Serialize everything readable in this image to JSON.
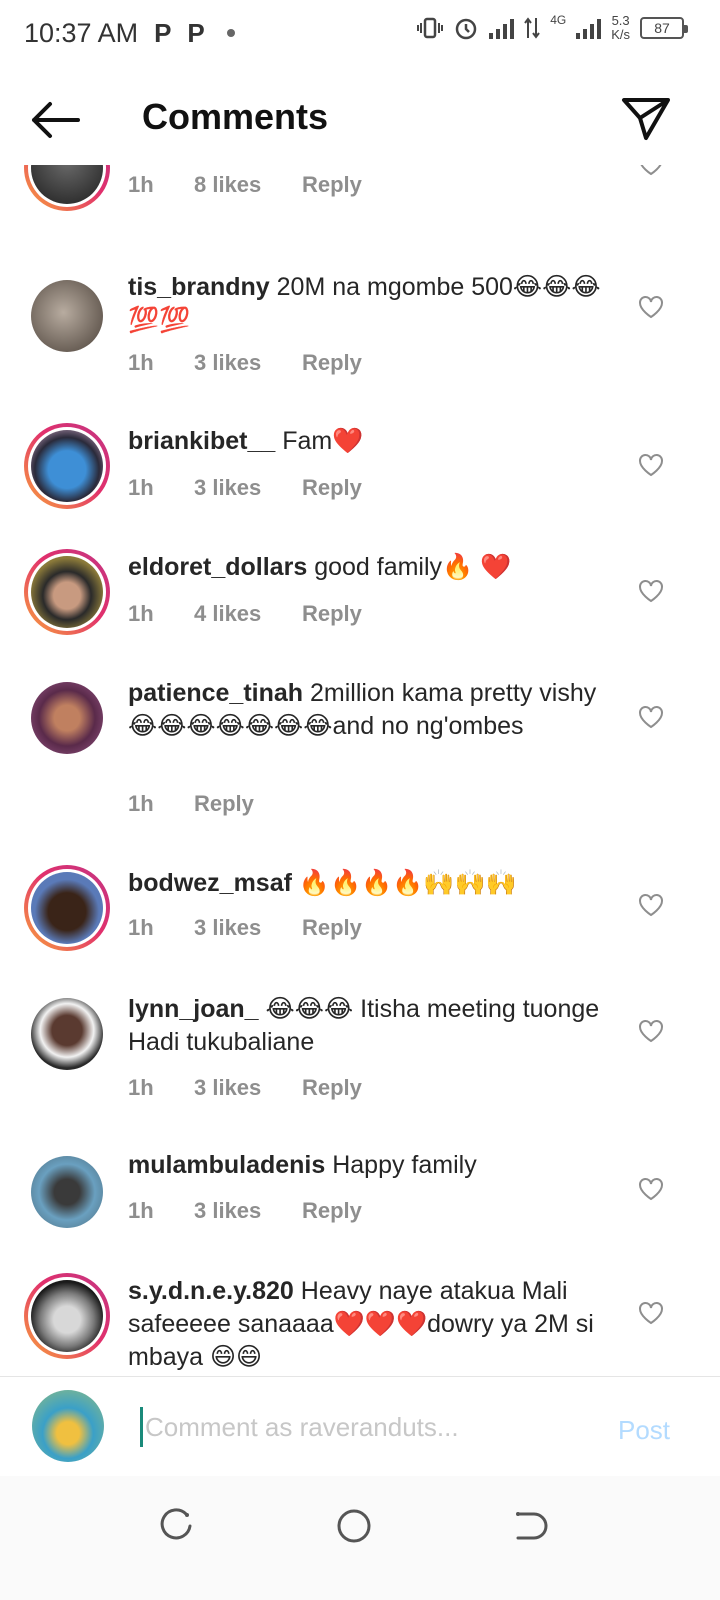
{
  "status_bar": {
    "time": "10:37 AM",
    "notif_icons": [
      "P",
      "P"
    ],
    "network": "4G",
    "speed_value": "5.3",
    "speed_unit": "K/s",
    "battery": "87"
  },
  "header": {
    "title": "Comments",
    "back_icon": "arrow-left-icon",
    "share_icon": "send-icon"
  },
  "comments": [
    {
      "username": "",
      "text": "",
      "time": "1h",
      "likes": "8 likes",
      "reply": "Reply",
      "avatar_color": "#3a3a3a",
      "has_ring": true
    },
    {
      "username": "tis_brandny",
      "text": "20M na mgombe 500😂😂😂💯💯",
      "time": "1h",
      "likes": "3 likes",
      "reply": "Reply",
      "avatar_color": "#8a7c70",
      "has_ring": false
    },
    {
      "username": "briankibet__",
      "text": "Fam❤️",
      "time": "1h",
      "likes": "3 likes",
      "reply": "Reply",
      "avatar_color": "#3e8fd6",
      "has_ring": true
    },
    {
      "username": "eldoret_dollars",
      "text": "good family🔥 ❤️",
      "time": "1h",
      "likes": "4 likes",
      "reply": "Reply",
      "avatar_color": "#8b7a3a",
      "has_ring": true
    },
    {
      "username": "patience_tinah",
      "text": "2million kama pretty vishy 😂😂😂😂😂😂😂and no ng'ombes",
      "time": "1h",
      "likes": "",
      "reply": "Reply",
      "avatar_color": "#9a5a8a",
      "has_ring": false
    },
    {
      "username": "bodwez_msaf",
      "text": "🔥🔥🔥🔥🙌🙌🙌",
      "time": "1h",
      "likes": "3 likes",
      "reply": "Reply",
      "avatar_color": "#5a7ab8",
      "has_ring": true
    },
    {
      "username": "lynn_joan_",
      "text": "😂😂😂 Itisha meeting tuonge Hadi tukubaliane",
      "time": "1h",
      "likes": "3 likes",
      "reply": "Reply",
      "avatar_color": "#6a5a5a",
      "has_ring": false
    },
    {
      "username": "mulambuladenis",
      "text": "Happy family",
      "time": "1h",
      "likes": "3 likes",
      "reply": "Reply",
      "avatar_color": "#4a6a7a",
      "has_ring": false
    },
    {
      "username": "s.y.d.n.e.y.820",
      "text": "Heavy naye atakua Mali safeeeee sanaaaa❤️❤️❤️dowry ya 2M si mbaya 😄😄",
      "time": "",
      "likes": "",
      "reply": "",
      "avatar_color": "#7a7a7a",
      "has_ring": true
    }
  ],
  "composer": {
    "placeholder": "Comment as raveranduts...",
    "post_label": "Post"
  },
  "colors": {
    "meta_gray": "#8e8e8e",
    "post_disabled": "#b3dbff"
  }
}
